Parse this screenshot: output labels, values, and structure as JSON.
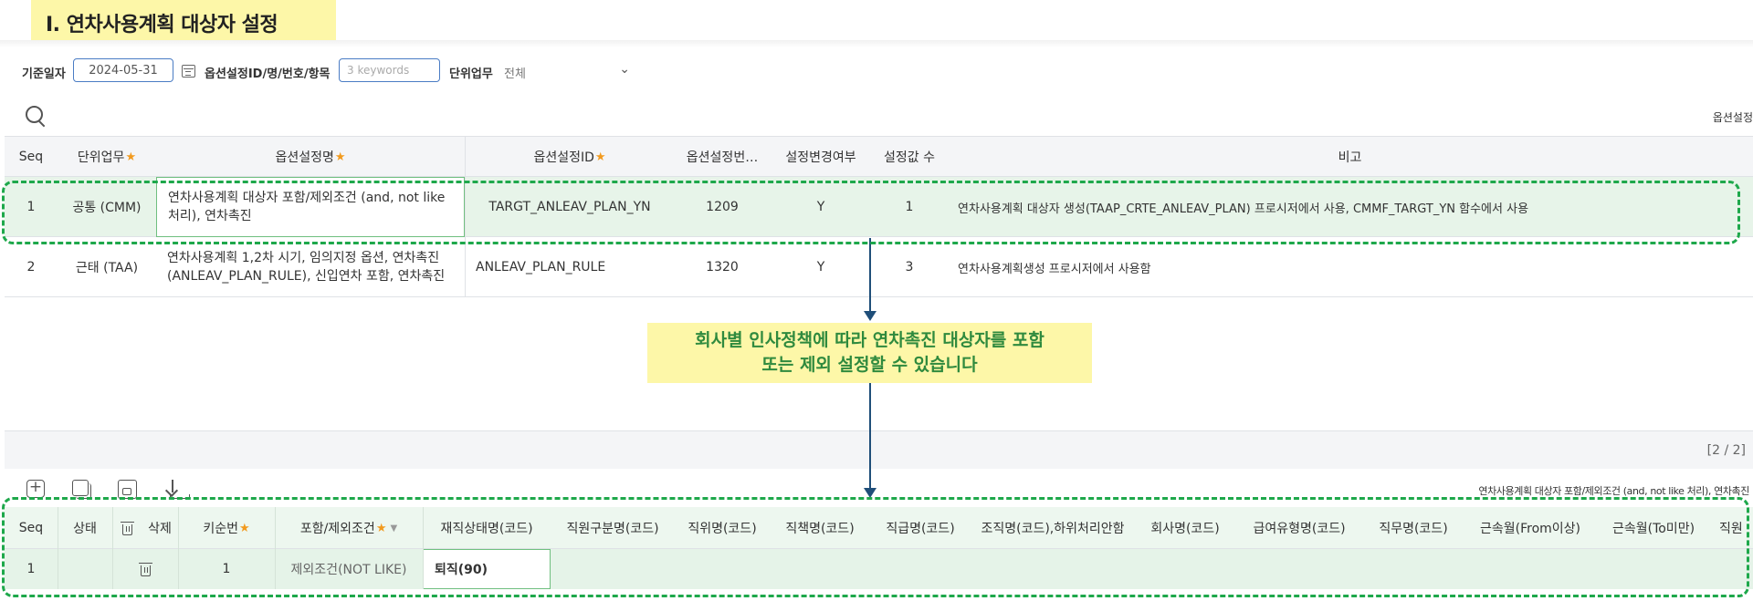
{
  "page_title": "I. 연차사용계획 대상자 설정",
  "filters": {
    "date_label": "기준일자",
    "date_value": "2024-05-31",
    "option_label": "옵션설정ID/명/번호/항목",
    "option_placeholder": "3 keywords",
    "unit_label": "단위업무",
    "unit_value": "전체"
  },
  "upper_right_label": "옵션설정",
  "grid1": {
    "headers": {
      "seq": "Seq",
      "unit": "단위업무",
      "name": "옵션설정명",
      "id": "옵션설정ID",
      "no": "옵션설정번…",
      "changed": "설정변경여부",
      "count": "설정값 수",
      "note": "비고"
    },
    "rows": [
      {
        "seq": "1",
        "unit": "공통 (CMM)",
        "name": "연차사용계획 대상자 포함/제외조건 (and, not like 처리), 연차촉진",
        "id": "TARGT_ANLEAV_PLAN_YN",
        "no": "1209",
        "changed": "Y",
        "count": "1",
        "note": "연차사용계획 대상자 생성(TAAP_CRTE_ANLEAV_PLAN) 프로시저에서 사용, CMMF_TARGT_YN 함수에서 사용"
      },
      {
        "seq": "2",
        "unit": "근태 (TAA)",
        "name": "연차사용계획 1,2차 시기, 임의지정 옵션, 연차촉진 (ANLEAV_PLAN_RULE), 신입연차 포함, 연차촉진",
        "id": "ANLEAV_PLAN_RULE",
        "no": "1320",
        "changed": "Y",
        "count": "3",
        "note": "연차사용계획생성 프로시저에서 사용함"
      }
    ],
    "pager": "[2 / 2]"
  },
  "callout": {
    "line1": "회사별 인사정책에 따라 연차촉진 대상자를 포함",
    "line2": "또는 제외 설정할 수 있습니다"
  },
  "sub_title": "연차사용계획 대상자 포함/제외조건 (and, not like 처리), 연차촉진",
  "grid2": {
    "headers": {
      "seq": "Seq",
      "status": "상태",
      "delete": "삭제",
      "key_no": "키순번",
      "incl_excl": "포함/제외조건",
      "emp_status": "재직상태명(코드)",
      "emp_type": "직원구분명(코드)",
      "position": "직위명(코드)",
      "duty": "직책명(코드)",
      "grade": "직급명(코드)",
      "org": "조직명(코드),하위처리안함",
      "company": "회사명(코드)",
      "pay_type": "급여유형명(코드)",
      "job": "직무명(코드)",
      "tenure_from": "근속월(From이상)",
      "tenure_to": "근속월(To미만)",
      "last": "직원"
    },
    "row": {
      "seq": "1",
      "key_no": "1",
      "incl_excl": "제외조건(NOT LIKE)",
      "emp_status": "퇴직(90)"
    }
  },
  "colors": {
    "accent_blue": "#4a7cc4",
    "highlight_yellow": "#fdf7a8",
    "callout_green": "#2f8a3e",
    "dash_green": "#1ea84b",
    "arrow_navy": "#1f4e79",
    "required_orange": "#f29a1e"
  },
  "icons": [
    "calendar-icon",
    "search-icon",
    "chevron-down-icon",
    "add-icon",
    "copy-icon",
    "save-icon",
    "download-icon",
    "trash-icon"
  ]
}
